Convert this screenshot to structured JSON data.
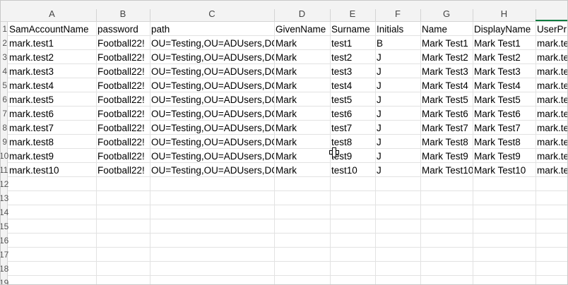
{
  "spreadsheet": {
    "column_letters": [
      "A",
      "B",
      "C",
      "D",
      "E",
      "F",
      "G",
      "H",
      ""
    ],
    "selected_column_index": 8,
    "row_numbers": [
      "1",
      "2",
      "3",
      "4",
      "5",
      "6",
      "7",
      "8",
      "9",
      "10",
      "11",
      "12",
      "13",
      "14",
      "15",
      "16",
      "17",
      "18",
      "19"
    ],
    "rows": [
      [
        "SamAccountName",
        "password",
        "path",
        "GivenName",
        "Surname",
        "Initials",
        "Name",
        "DisplayName",
        "UserPr"
      ],
      [
        "mark.test1",
        "Football22!",
        "OU=Testing,OU=ADUsers,DC",
        "Mark",
        "test1",
        "B",
        "Mark Test1",
        "Mark Test1",
        "mark.te"
      ],
      [
        "mark.test2",
        "Football22!",
        "OU=Testing,OU=ADUsers,DC",
        "Mark",
        "test2",
        "J",
        "Mark Test2",
        "Mark Test2",
        "mark.te"
      ],
      [
        "mark.test3",
        "Football22!",
        "OU=Testing,OU=ADUsers,DC",
        "Mark",
        "test3",
        "J",
        "Mark Test3",
        "Mark Test3",
        "mark.te"
      ],
      [
        "mark.test4",
        "Football22!",
        "OU=Testing,OU=ADUsers,DC",
        "Mark",
        "test4",
        "J",
        "Mark Test4",
        "Mark Test4",
        "mark.te"
      ],
      [
        "mark.test5",
        "Football22!",
        "OU=Testing,OU=ADUsers,DC",
        "Mark",
        "test5",
        "J",
        "Mark Test5",
        "Mark Test5",
        "mark.te"
      ],
      [
        "mark.test6",
        "Football22!",
        "OU=Testing,OU=ADUsers,DC",
        "Mark",
        "test6",
        "J",
        "Mark Test6",
        "Mark Test6",
        "mark.te"
      ],
      [
        "mark.test7",
        "Football22!",
        "OU=Testing,OU=ADUsers,DC",
        "Mark",
        "test7",
        "J",
        "Mark Test7",
        "Mark Test7",
        "mark.te"
      ],
      [
        "mark.test8",
        "Football22!",
        "OU=Testing,OU=ADUsers,DC",
        "Mark",
        "test8",
        "J",
        "Mark Test8",
        "Mark Test8",
        "mark.te"
      ],
      [
        "mark.test9",
        "Football22!",
        "OU=Testing,OU=ADUsers,DC",
        "Mark",
        "test9",
        "J",
        "Mark Test9",
        "Mark Test9",
        "mark.te"
      ],
      [
        "mark.test10",
        "Football22!",
        "OU=Testing,OU=ADUsers,DC",
        "Mark",
        "test10",
        "J",
        "Mark Test10",
        "Mark Test10",
        "mark.te"
      ]
    ],
    "colors": {
      "accent": "#107c41",
      "header_bg": "#f3f3f3",
      "grid": "#e2e2e2"
    },
    "cursor_icon": "cell-select-cross-icon"
  }
}
